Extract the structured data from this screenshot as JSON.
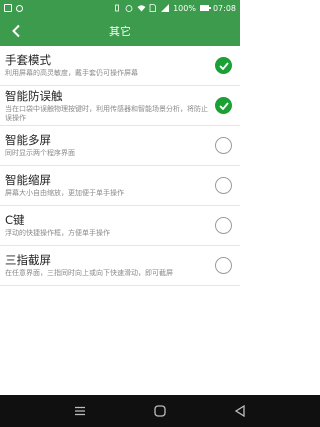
{
  "statusbar": {
    "battery": "100%",
    "time": "07:08"
  },
  "header": {
    "title": "其它"
  },
  "settings": [
    {
      "title": "手套模式",
      "desc": "利用屏幕的高灵敏度，戴手套仍可操作屏幕",
      "checked": true
    },
    {
      "title": "智能防误触",
      "desc": "当在口袋中误触物理按键时，利用传感器和智能场景分析，将防止误操作",
      "checked": true
    },
    {
      "title": "智能多屏",
      "desc": "同时显示两个程序界面",
      "checked": false
    },
    {
      "title": "智能缩屏",
      "desc": "屏幕大小自由缩放，更加便于单手操作",
      "checked": false
    },
    {
      "title": "C键",
      "desc": "浮动的快捷操作框，方便单手操作",
      "checked": false
    },
    {
      "title": "三指截屏",
      "desc": "在任意界面，三指同时向上或向下快速滑动，即可截屏",
      "checked": false
    }
  ],
  "colors": {
    "accent": "#3c9b4c",
    "check_on": "#1aa034"
  }
}
